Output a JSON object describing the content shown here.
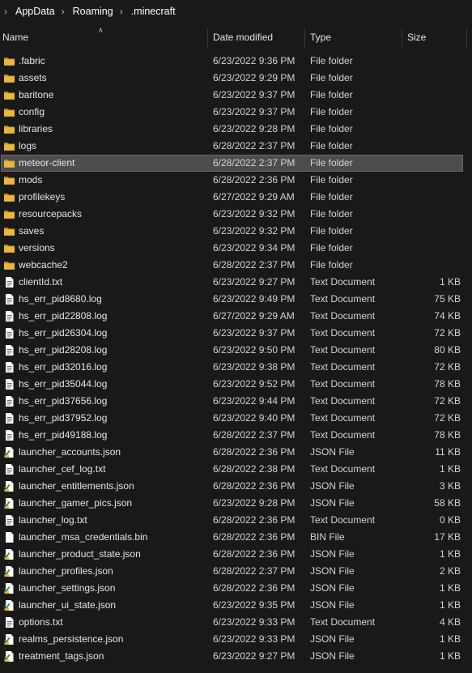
{
  "breadcrumb": [
    "AppData",
    "Roaming",
    ".minecraft"
  ],
  "columns": {
    "name": "Name",
    "date": "Date modified",
    "type": "Type",
    "size": "Size"
  },
  "selected_index": 6,
  "colors": {
    "folder": "#e8b73f",
    "background": "#191919",
    "selection": "#4d4d4d"
  },
  "files": [
    {
      "name": ".fabric",
      "date": "6/23/2022 9:36 PM",
      "type": "File folder",
      "size": "",
      "icon": "folder-icon"
    },
    {
      "name": "assets",
      "date": "6/23/2022 9:29 PM",
      "type": "File folder",
      "size": "",
      "icon": "folder-icon"
    },
    {
      "name": "baritone",
      "date": "6/23/2022 9:37 PM",
      "type": "File folder",
      "size": "",
      "icon": "folder-icon"
    },
    {
      "name": "config",
      "date": "6/23/2022 9:37 PM",
      "type": "File folder",
      "size": "",
      "icon": "folder-icon"
    },
    {
      "name": "libraries",
      "date": "6/23/2022 9:28 PM",
      "type": "File folder",
      "size": "",
      "icon": "folder-icon"
    },
    {
      "name": "logs",
      "date": "6/28/2022 2:37 PM",
      "type": "File folder",
      "size": "",
      "icon": "folder-icon"
    },
    {
      "name": "meteor-client",
      "date": "6/28/2022 2:37 PM",
      "type": "File folder",
      "size": "",
      "icon": "folder-icon"
    },
    {
      "name": "mods",
      "date": "6/28/2022 2:36 PM",
      "type": "File folder",
      "size": "",
      "icon": "folder-icon"
    },
    {
      "name": "profilekeys",
      "date": "6/27/2022 9:29 AM",
      "type": "File folder",
      "size": "",
      "icon": "folder-icon"
    },
    {
      "name": "resourcepacks",
      "date": "6/23/2022 9:32 PM",
      "type": "File folder",
      "size": "",
      "icon": "folder-icon"
    },
    {
      "name": "saves",
      "date": "6/23/2022 9:32 PM",
      "type": "File folder",
      "size": "",
      "icon": "folder-icon"
    },
    {
      "name": "versions",
      "date": "6/23/2022 9:34 PM",
      "type": "File folder",
      "size": "",
      "icon": "folder-icon"
    },
    {
      "name": "webcache2",
      "date": "6/28/2022 2:37 PM",
      "type": "File folder",
      "size": "",
      "icon": "folder-icon"
    },
    {
      "name": "clientId.txt",
      "date": "6/23/2022 9:27 PM",
      "type": "Text Document",
      "size": "1 KB",
      "icon": "text-document-icon"
    },
    {
      "name": "hs_err_pid8680.log",
      "date": "6/23/2022 9:49 PM",
      "type": "Text Document",
      "size": "75 KB",
      "icon": "text-document-icon"
    },
    {
      "name": "hs_err_pid22808.log",
      "date": "6/27/2022 9:29 AM",
      "type": "Text Document",
      "size": "74 KB",
      "icon": "text-document-icon"
    },
    {
      "name": "hs_err_pid26304.log",
      "date": "6/23/2022 9:37 PM",
      "type": "Text Document",
      "size": "72 KB",
      "icon": "text-document-icon"
    },
    {
      "name": "hs_err_pid28208.log",
      "date": "6/23/2022 9:50 PM",
      "type": "Text Document",
      "size": "80 KB",
      "icon": "text-document-icon"
    },
    {
      "name": "hs_err_pid32016.log",
      "date": "6/23/2022 9:38 PM",
      "type": "Text Document",
      "size": "72 KB",
      "icon": "text-document-icon"
    },
    {
      "name": "hs_err_pid35044.log",
      "date": "6/23/2022 9:52 PM",
      "type": "Text Document",
      "size": "78 KB",
      "icon": "text-document-icon"
    },
    {
      "name": "hs_err_pid37656.log",
      "date": "6/23/2022 9:44 PM",
      "type": "Text Document",
      "size": "72 KB",
      "icon": "text-document-icon"
    },
    {
      "name": "hs_err_pid37952.log",
      "date": "6/23/2022 9:40 PM",
      "type": "Text Document",
      "size": "72 KB",
      "icon": "text-document-icon"
    },
    {
      "name": "hs_err_pid49188.log",
      "date": "6/28/2022 2:37 PM",
      "type": "Text Document",
      "size": "78 KB",
      "icon": "text-document-icon"
    },
    {
      "name": "launcher_accounts.json",
      "date": "6/28/2022 2:36 PM",
      "type": "JSON File",
      "size": "11 KB",
      "icon": "json-file-icon"
    },
    {
      "name": "launcher_cef_log.txt",
      "date": "6/28/2022 2:38 PM",
      "type": "Text Document",
      "size": "1 KB",
      "icon": "text-document-icon"
    },
    {
      "name": "launcher_entitlements.json",
      "date": "6/28/2022 2:36 PM",
      "type": "JSON File",
      "size": "3 KB",
      "icon": "json-file-icon"
    },
    {
      "name": "launcher_gamer_pics.json",
      "date": "6/23/2022 9:28 PM",
      "type": "JSON File",
      "size": "58 KB",
      "icon": "json-file-icon"
    },
    {
      "name": "launcher_log.txt",
      "date": "6/28/2022 2:36 PM",
      "type": "Text Document",
      "size": "0 KB",
      "icon": "text-document-icon"
    },
    {
      "name": "launcher_msa_credentials.bin",
      "date": "6/28/2022 2:36 PM",
      "type": "BIN File",
      "size": "17 KB",
      "icon": "bin-file-icon"
    },
    {
      "name": "launcher_product_state.json",
      "date": "6/28/2022 2:36 PM",
      "type": "JSON File",
      "size": "1 KB",
      "icon": "json-file-icon"
    },
    {
      "name": "launcher_profiles.json",
      "date": "6/28/2022 2:37 PM",
      "type": "JSON File",
      "size": "2 KB",
      "icon": "json-file-icon"
    },
    {
      "name": "launcher_settings.json",
      "date": "6/28/2022 2:36 PM",
      "type": "JSON File",
      "size": "1 KB",
      "icon": "json-file-icon"
    },
    {
      "name": "launcher_ui_state.json",
      "date": "6/23/2022 9:35 PM",
      "type": "JSON File",
      "size": "1 KB",
      "icon": "json-file-icon"
    },
    {
      "name": "options.txt",
      "date": "6/23/2022 9:33 PM",
      "type": "Text Document",
      "size": "4 KB",
      "icon": "text-document-icon"
    },
    {
      "name": "realms_persistence.json",
      "date": "6/23/2022 9:33 PM",
      "type": "JSON File",
      "size": "1 KB",
      "icon": "json-file-icon"
    },
    {
      "name": "treatment_tags.json",
      "date": "6/23/2022 9:27 PM",
      "type": "JSON File",
      "size": "1 KB",
      "icon": "json-file-icon"
    }
  ]
}
